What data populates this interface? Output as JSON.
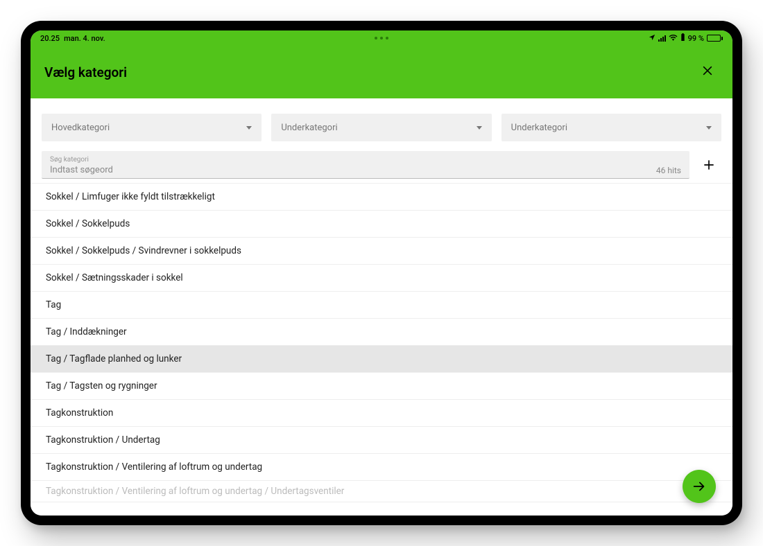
{
  "status": {
    "time": "20.25",
    "date": "man. 4. nov.",
    "battery_pct": "99 %"
  },
  "header": {
    "title": "Vælg kategori"
  },
  "dropdowns": {
    "main": "Hovedkategori",
    "sub1": "Underkategori",
    "sub2": "Underkategori"
  },
  "search": {
    "label": "Søg kategori",
    "placeholder": "Indtast søgeord",
    "hits": "46 hits"
  },
  "items": [
    {
      "label": "Sokkel / Limfuger ikke fyldt tilstrækkeligt",
      "selected": false
    },
    {
      "label": "Sokkel / Sokkelpuds",
      "selected": false
    },
    {
      "label": "Sokkel / Sokkelpuds / Svindrevner i sokkelpuds",
      "selected": false
    },
    {
      "label": "Sokkel / Sætningsskader i sokkel",
      "selected": false
    },
    {
      "label": "Tag",
      "selected": false
    },
    {
      "label": "Tag / Inddækninger",
      "selected": false
    },
    {
      "label": "Tag / Tagflade planhed og lunker",
      "selected": true
    },
    {
      "label": "Tag / Tagsten og rygninger",
      "selected": false
    },
    {
      "label": "Tagkonstruktion",
      "selected": false
    },
    {
      "label": "Tagkonstruktion / Undertag",
      "selected": false
    },
    {
      "label": "Tagkonstruktion / Ventilering af loftrum og undertag",
      "selected": false
    },
    {
      "label": "Tagkonstruktion / Ventilering af loftrum og undertag / Undertagsventiler",
      "selected": false
    }
  ],
  "colors": {
    "accent": "#52c41a"
  }
}
